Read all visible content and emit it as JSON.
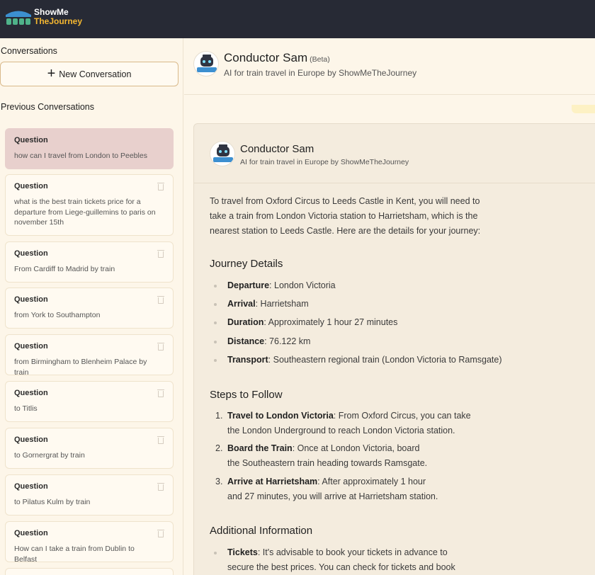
{
  "brand": {
    "line1": "ShowMe",
    "line2": "TheJourney"
  },
  "sidebar": {
    "conversations_heading": "Conversations",
    "new_conversation_label": "New Conversation",
    "previous_heading": "Previous Conversations",
    "items": [
      {
        "title": "Question",
        "text": "how can I travel from London to Peebles"
      },
      {
        "title": "Question",
        "text": "what is the best train tickets price for a departure from Liege-guillemins to paris on november 15th"
      },
      {
        "title": "Question",
        "text": "From Cardiff to Madrid by train"
      },
      {
        "title": "Question",
        "text": "from York to Southampton"
      },
      {
        "title": "Question",
        "text": "from Birmingham to Blenheim Palace by train"
      },
      {
        "title": "Question",
        "text": "to Titlis"
      },
      {
        "title": "Question",
        "text": "to Gornergrat by train"
      },
      {
        "title": "Question",
        "text": "to Pilatus Kulm by train"
      },
      {
        "title": "Question",
        "text": "How can I take a train from Dublin to Belfast"
      }
    ]
  },
  "header": {
    "title": "Conductor Sam",
    "badge": "(Beta)",
    "subtitle": "AI for train travel in Europe by ShowMeTheJourney"
  },
  "message": {
    "sender": "Conductor Sam",
    "sender_sub": "AI for train travel in Europe by ShowMeTheJourney",
    "intro": [
      "To travel from Oxford Circus to Leeds Castle in Kent, you will need to",
      "take a train from London Victoria station to Harrietsham, which is the",
      "nearest station to Leeds Castle. Here are the details for your journey:"
    ],
    "journey_heading": "Journey Details",
    "journey": [
      {
        "label": "Departure",
        "value": ": London Victoria"
      },
      {
        "label": "Arrival",
        "value": ": Harrietsham"
      },
      {
        "label": "Duration",
        "value": ": Approximately 1 hour 27 minutes"
      },
      {
        "label": "Distance",
        "value": ": 76.122 km"
      },
      {
        "label": "Transport",
        "value": ": Southeastern regional train (London Victoria to Ramsgate)"
      }
    ],
    "steps_heading": "Steps to Follow",
    "steps": [
      {
        "num": "1.",
        "label": "Travel to London Victoria",
        "l1": ": From Oxford Circus, you can take",
        "l2": "the London Underground to reach London Victoria station."
      },
      {
        "num": "2.",
        "label": "Board the Train",
        "l1": ": Once at London Victoria, board",
        "l2": "the Southeastern train heading towards Ramsgate."
      },
      {
        "num": "3.",
        "label": "Arrive at Harrietsham",
        "l1": ": After approximately 1 hour",
        "l2": "and 27 minutes, you will arrive at Harrietsham station."
      }
    ],
    "additional_heading": "Additional Information",
    "additional": [
      {
        "label": "Tickets",
        "l1": ": It's advisable to book your tickets in advance to",
        "l2": "secure the best prices. You can check for tickets and book"
      }
    ]
  }
}
